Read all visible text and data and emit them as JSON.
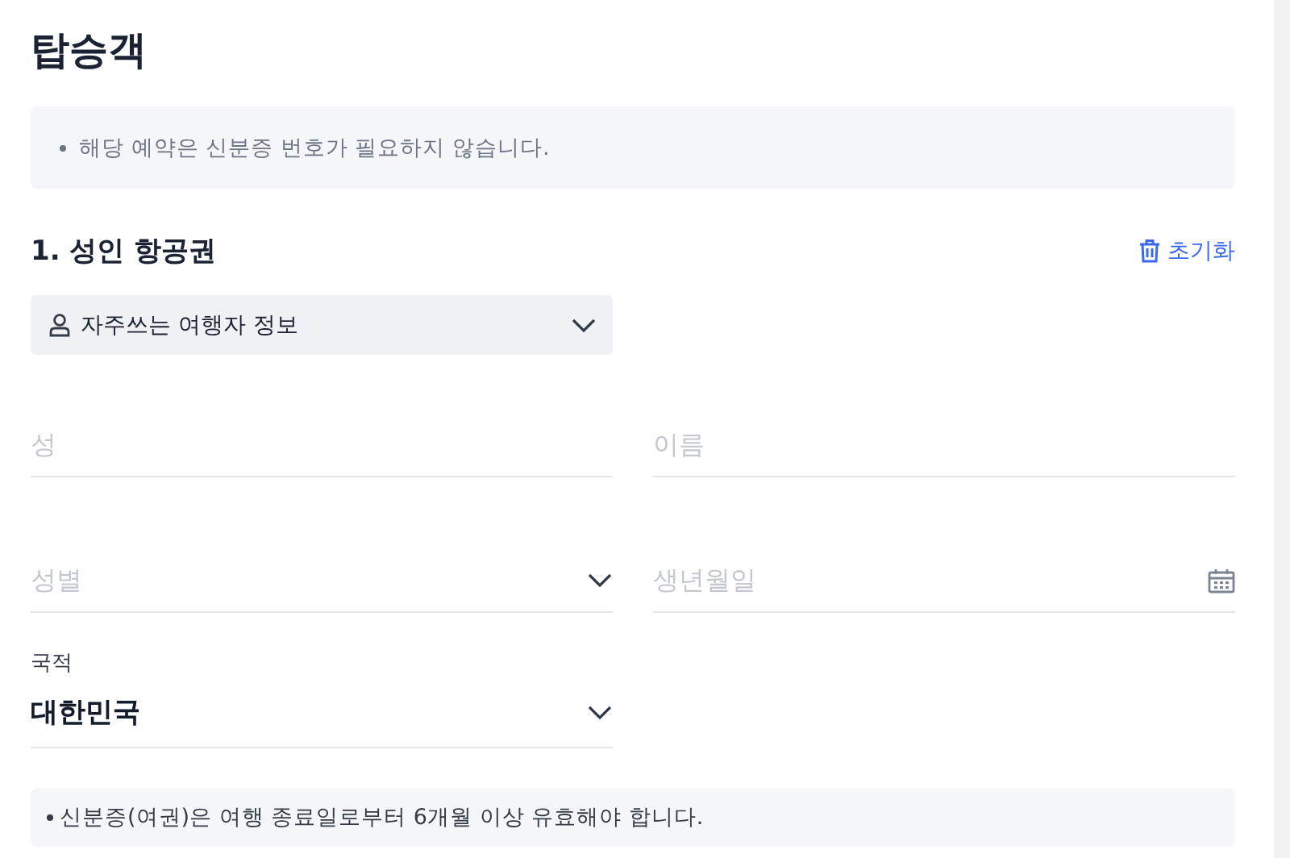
{
  "title": "탑승객",
  "notice": "해당 예약은 신분증 번호가 필요하지 않습니다.",
  "section": {
    "heading": "1. 성인 항공권",
    "reset": "초기화"
  },
  "saved_travelers": {
    "label": "자주쓰는 여행자 정보"
  },
  "fields": [
    {
      "kind": "text",
      "placeholder": "성"
    },
    {
      "kind": "text",
      "placeholder": "이름"
    },
    {
      "kind": "select",
      "placeholder": "성별"
    },
    {
      "kind": "date",
      "placeholder": "생년월일"
    },
    {
      "kind": "select",
      "label": "국적",
      "value": "대한민국"
    }
  ],
  "footnote": "신분증(여권)은 여행 종료일로부터 6개월 이상 유효해야 합니다."
}
